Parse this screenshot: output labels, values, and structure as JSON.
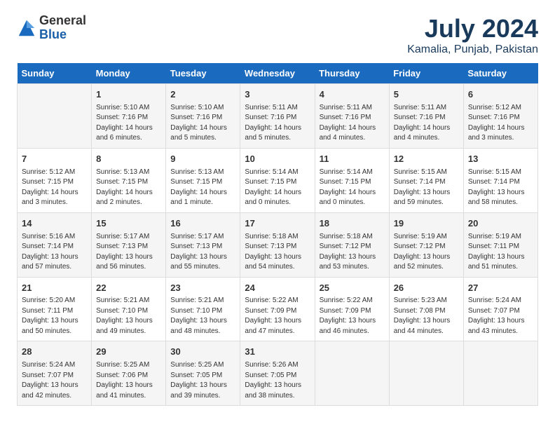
{
  "logo": {
    "general": "General",
    "blue": "Blue"
  },
  "title": "July 2024",
  "subtitle": "Kamalia, Punjab, Pakistan",
  "days": [
    "Sunday",
    "Monday",
    "Tuesday",
    "Wednesday",
    "Thursday",
    "Friday",
    "Saturday"
  ],
  "weeks": [
    [
      {
        "day": "",
        "info": ""
      },
      {
        "day": "1",
        "info": "Sunrise: 5:10 AM\nSunset: 7:16 PM\nDaylight: 14 hours\nand 6 minutes."
      },
      {
        "day": "2",
        "info": "Sunrise: 5:10 AM\nSunset: 7:16 PM\nDaylight: 14 hours\nand 5 minutes."
      },
      {
        "day": "3",
        "info": "Sunrise: 5:11 AM\nSunset: 7:16 PM\nDaylight: 14 hours\nand 5 minutes."
      },
      {
        "day": "4",
        "info": "Sunrise: 5:11 AM\nSunset: 7:16 PM\nDaylight: 14 hours\nand 4 minutes."
      },
      {
        "day": "5",
        "info": "Sunrise: 5:11 AM\nSunset: 7:16 PM\nDaylight: 14 hours\nand 4 minutes."
      },
      {
        "day": "6",
        "info": "Sunrise: 5:12 AM\nSunset: 7:16 PM\nDaylight: 14 hours\nand 3 minutes."
      }
    ],
    [
      {
        "day": "7",
        "info": "Sunrise: 5:12 AM\nSunset: 7:15 PM\nDaylight: 14 hours\nand 3 minutes."
      },
      {
        "day": "8",
        "info": "Sunrise: 5:13 AM\nSunset: 7:15 PM\nDaylight: 14 hours\nand 2 minutes."
      },
      {
        "day": "9",
        "info": "Sunrise: 5:13 AM\nSunset: 7:15 PM\nDaylight: 14 hours\nand 1 minute."
      },
      {
        "day": "10",
        "info": "Sunrise: 5:14 AM\nSunset: 7:15 PM\nDaylight: 14 hours\nand 0 minutes."
      },
      {
        "day": "11",
        "info": "Sunrise: 5:14 AM\nSunset: 7:15 PM\nDaylight: 14 hours\nand 0 minutes."
      },
      {
        "day": "12",
        "info": "Sunrise: 5:15 AM\nSunset: 7:14 PM\nDaylight: 13 hours\nand 59 minutes."
      },
      {
        "day": "13",
        "info": "Sunrise: 5:15 AM\nSunset: 7:14 PM\nDaylight: 13 hours\nand 58 minutes."
      }
    ],
    [
      {
        "day": "14",
        "info": "Sunrise: 5:16 AM\nSunset: 7:14 PM\nDaylight: 13 hours\nand 57 minutes."
      },
      {
        "day": "15",
        "info": "Sunrise: 5:17 AM\nSunset: 7:13 PM\nDaylight: 13 hours\nand 56 minutes."
      },
      {
        "day": "16",
        "info": "Sunrise: 5:17 AM\nSunset: 7:13 PM\nDaylight: 13 hours\nand 55 minutes."
      },
      {
        "day": "17",
        "info": "Sunrise: 5:18 AM\nSunset: 7:13 PM\nDaylight: 13 hours\nand 54 minutes."
      },
      {
        "day": "18",
        "info": "Sunrise: 5:18 AM\nSunset: 7:12 PM\nDaylight: 13 hours\nand 53 minutes."
      },
      {
        "day": "19",
        "info": "Sunrise: 5:19 AM\nSunset: 7:12 PM\nDaylight: 13 hours\nand 52 minutes."
      },
      {
        "day": "20",
        "info": "Sunrise: 5:19 AM\nSunset: 7:11 PM\nDaylight: 13 hours\nand 51 minutes."
      }
    ],
    [
      {
        "day": "21",
        "info": "Sunrise: 5:20 AM\nSunset: 7:11 PM\nDaylight: 13 hours\nand 50 minutes."
      },
      {
        "day": "22",
        "info": "Sunrise: 5:21 AM\nSunset: 7:10 PM\nDaylight: 13 hours\nand 49 minutes."
      },
      {
        "day": "23",
        "info": "Sunrise: 5:21 AM\nSunset: 7:10 PM\nDaylight: 13 hours\nand 48 minutes."
      },
      {
        "day": "24",
        "info": "Sunrise: 5:22 AM\nSunset: 7:09 PM\nDaylight: 13 hours\nand 47 minutes."
      },
      {
        "day": "25",
        "info": "Sunrise: 5:22 AM\nSunset: 7:09 PM\nDaylight: 13 hours\nand 46 minutes."
      },
      {
        "day": "26",
        "info": "Sunrise: 5:23 AM\nSunset: 7:08 PM\nDaylight: 13 hours\nand 44 minutes."
      },
      {
        "day": "27",
        "info": "Sunrise: 5:24 AM\nSunset: 7:07 PM\nDaylight: 13 hours\nand 43 minutes."
      }
    ],
    [
      {
        "day": "28",
        "info": "Sunrise: 5:24 AM\nSunset: 7:07 PM\nDaylight: 13 hours\nand 42 minutes."
      },
      {
        "day": "29",
        "info": "Sunrise: 5:25 AM\nSunset: 7:06 PM\nDaylight: 13 hours\nand 41 minutes."
      },
      {
        "day": "30",
        "info": "Sunrise: 5:25 AM\nSunset: 7:05 PM\nDaylight: 13 hours\nand 39 minutes."
      },
      {
        "day": "31",
        "info": "Sunrise: 5:26 AM\nSunset: 7:05 PM\nDaylight: 13 hours\nand 38 minutes."
      },
      {
        "day": "",
        "info": ""
      },
      {
        "day": "",
        "info": ""
      },
      {
        "day": "",
        "info": ""
      }
    ]
  ]
}
